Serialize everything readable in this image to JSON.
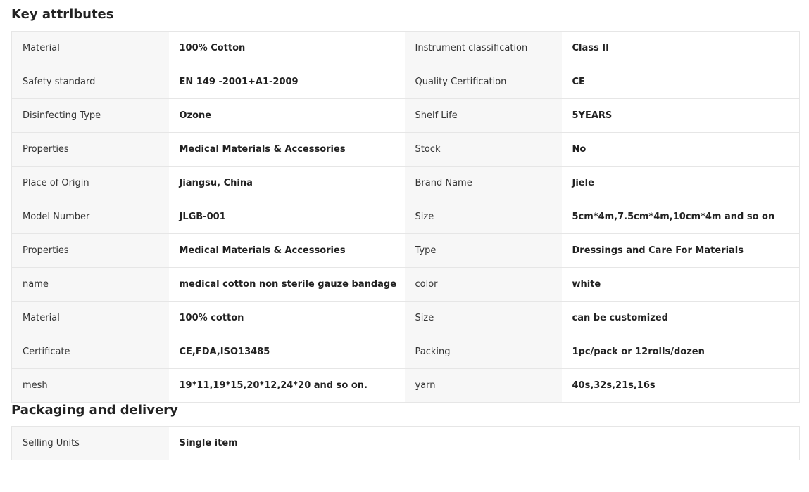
{
  "key_attributes": {
    "title": "Key attributes",
    "rows": [
      [
        "Material",
        "100% Cotton",
        "Instrument classification",
        "Class II"
      ],
      [
        "Safety standard",
        "EN 149 -2001+A1-2009",
        "Quality Certification",
        "CE"
      ],
      [
        "Disinfecting Type",
        "Ozone",
        "Shelf Life",
        "5YEARS"
      ],
      [
        "Properties",
        "Medical Materials & Accessories",
        "Stock",
        "No"
      ],
      [
        "Place of Origin",
        "Jiangsu, China",
        "Brand Name",
        "Jiele"
      ],
      [
        "Model Number",
        "JLGB-001",
        "Size",
        "5cm*4m,7.5cm*4m,10cm*4m and so on"
      ],
      [
        "Properties",
        "Medical Materials & Accessories",
        "Type",
        "Dressings and Care For Materials"
      ],
      [
        "name",
        "medical cotton non sterile gauze bandage",
        "color",
        "white"
      ],
      [
        "Material",
        "100% cotton",
        "Size",
        "can be customized"
      ],
      [
        "Certificate",
        "CE,FDA,ISO13485",
        "Packing",
        "1pc/pack or 12rolls/dozen"
      ],
      [
        "mesh",
        "19*11,19*15,20*12,24*20 and so on.",
        "yarn",
        "40s,32s,21s,16s"
      ]
    ]
  },
  "packaging": {
    "title": "Packaging and delivery",
    "rows": [
      [
        "Selling Units",
        "Single item"
      ]
    ]
  }
}
